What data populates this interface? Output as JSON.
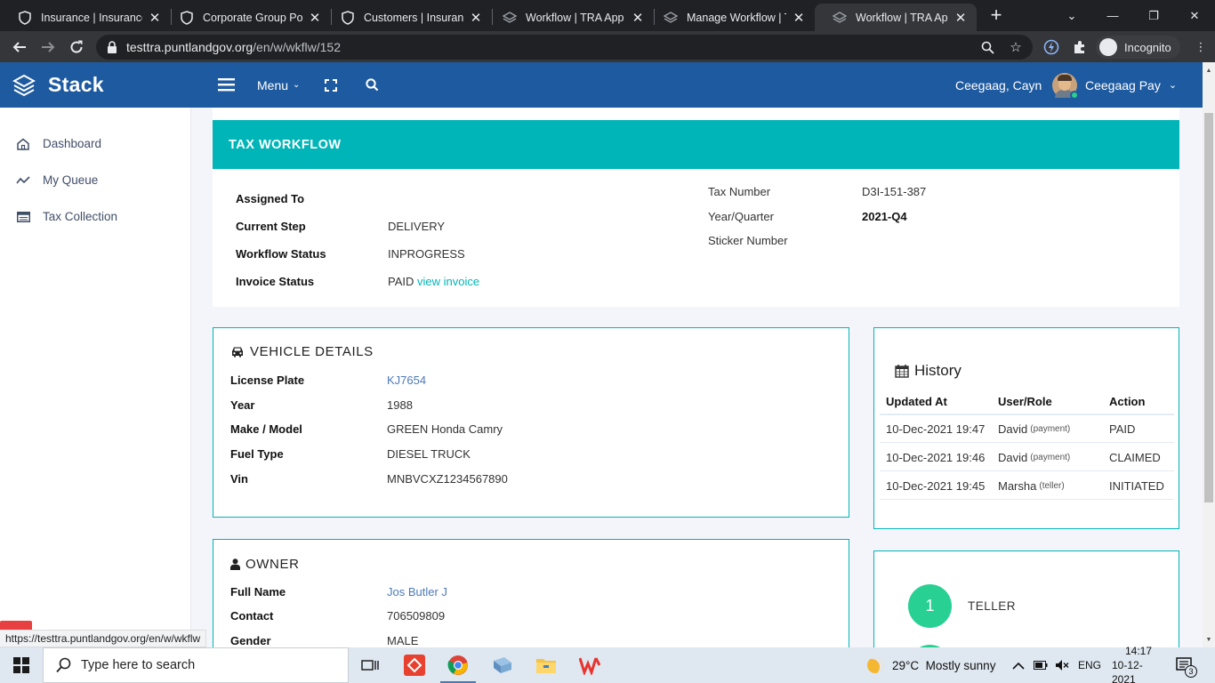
{
  "browser": {
    "tabs": [
      {
        "title": "Insurance | Insurance",
        "active": false
      },
      {
        "title": "Corporate Group Polic",
        "active": false
      },
      {
        "title": "Customers | Insurance",
        "active": false
      },
      {
        "title": "Workflow | TRA App",
        "active": false
      },
      {
        "title": "Manage Workflow | TF",
        "active": false
      },
      {
        "title": "Workflow | TRA App",
        "active": true
      }
    ],
    "url_host": "testtra.puntlandgov.org",
    "url_path": "/en/w/wkflw/152",
    "incognito_label": "Incognito",
    "status_url": "https://testtra.puntlandgov.org/en/w/wkflw"
  },
  "header": {
    "brand": "Stack",
    "menu_label": "Menu",
    "user_short": "Ceegaag, Cayn",
    "user_name": "Ceegaag Pay"
  },
  "sidebar": {
    "items": [
      {
        "label": "Dashboard",
        "icon": "home-icon"
      },
      {
        "label": "My Queue",
        "icon": "trend-icon"
      },
      {
        "label": "Tax Collection",
        "icon": "list-icon"
      }
    ]
  },
  "workflow": {
    "title": "TAX WORKFLOW",
    "left": [
      {
        "label": "Assigned To",
        "value": ""
      },
      {
        "label": "Current Step",
        "value": "DELIVERY"
      },
      {
        "label": "Workflow Status",
        "value": "INPROGRESS"
      },
      {
        "label": "Invoice Status",
        "value": "PAID",
        "link": "view invoice"
      }
    ],
    "right": [
      {
        "label": "Tax Number",
        "value": "D3I-151-387"
      },
      {
        "label": "Year/Quarter",
        "value": "2021-Q4"
      },
      {
        "label": "Sticker Number",
        "value": ""
      }
    ]
  },
  "vehicle": {
    "title": "VEHICLE DETAILS",
    "rows": [
      {
        "label": "License Plate",
        "value": "KJ7654"
      },
      {
        "label": "Year",
        "value": "1988"
      },
      {
        "label": "Make / Model",
        "value": "GREEN Honda Camry"
      },
      {
        "label": "Fuel Type",
        "value": "DIESEL TRUCK"
      },
      {
        "label": "Vin",
        "value": "MNBVCXZ1234567890"
      }
    ]
  },
  "owner": {
    "title": "OWNER",
    "rows": [
      {
        "label": "Full Name",
        "value": "Jos Butler J"
      },
      {
        "label": "Contact",
        "value": "706509809"
      },
      {
        "label": "Gender",
        "value": "MALE"
      }
    ]
  },
  "history": {
    "title": "History",
    "columns": [
      "Updated At",
      "User/Role",
      "Action"
    ],
    "rows": [
      {
        "updated": "10-Dec-2021 19:47",
        "user": "David",
        "role": "(payment)",
        "action": "PAID"
      },
      {
        "updated": "10-Dec-2021 19:46",
        "user": "David",
        "role": "(payment)",
        "action": "CLAIMED"
      },
      {
        "updated": "10-Dec-2021 19:45",
        "user": "Marsha",
        "role": "(teller)",
        "action": "INITIATED"
      }
    ]
  },
  "steps": [
    {
      "number": "1",
      "label": "TELLER"
    }
  ],
  "taskbar": {
    "search_placeholder": "Type here to search",
    "weather": "29°C  Mostly sunny",
    "lang": "ENG",
    "time": "14:17",
    "date": "10-12-2021",
    "notifications": "3"
  },
  "colors": {
    "accent": "#00b5b8",
    "header": "#1e5aa0",
    "step": "#28d094"
  }
}
